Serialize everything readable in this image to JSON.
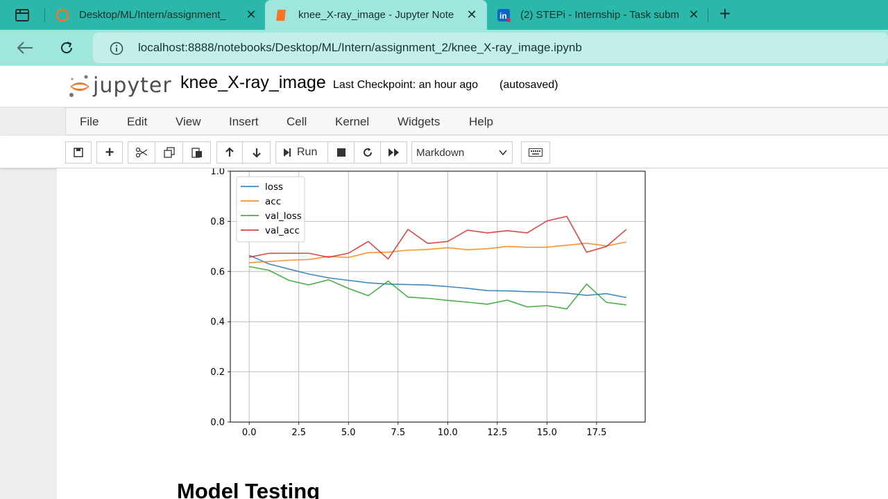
{
  "browser": {
    "tabs": [
      {
        "title": "Desktop/ML/Intern/assignment_",
        "icon": "jupyter-icon"
      },
      {
        "title": "knee_X-ray_image - Jupyter Note",
        "icon": "notebook-icon"
      },
      {
        "title": "(2) STEPi - Internship - Task subm",
        "icon": "linkedin-icon"
      }
    ],
    "url": "localhost:8888/notebooks/Desktop/ML/Intern/assignment_2/knee_X-ray_image.ipynb"
  },
  "jupyter": {
    "logo_text": "jupyter",
    "notebook_name": "knee_X-ray_image",
    "checkpoint": "Last Checkpoint: an hour ago",
    "autosave": "(autosaved)",
    "menu": [
      "File",
      "Edit",
      "View",
      "Insert",
      "Cell",
      "Kernel",
      "Widgets",
      "Help"
    ],
    "run_label": "Run",
    "cell_type": "Markdown"
  },
  "chart_data": {
    "type": "line",
    "x": [
      0,
      1,
      2,
      3,
      4,
      5,
      6,
      7,
      8,
      9,
      10,
      11,
      12,
      13,
      14,
      15,
      16,
      17,
      18,
      19
    ],
    "series": [
      {
        "name": "loss",
        "color": "#1f77b4",
        "values": [
          0.665,
          0.63,
          0.61,
          0.59,
          0.575,
          0.565,
          0.555,
          0.55,
          0.548,
          0.546,
          0.54,
          0.533,
          0.524,
          0.523,
          0.52,
          0.518,
          0.514,
          0.505,
          0.512,
          0.496
        ]
      },
      {
        "name": "acc",
        "color": "#ff7f0e",
        "values": [
          0.635,
          0.64,
          0.645,
          0.648,
          0.66,
          0.656,
          0.675,
          0.677,
          0.685,
          0.688,
          0.695,
          0.687,
          0.691,
          0.7,
          0.697,
          0.697,
          0.705,
          0.713,
          0.702,
          0.718
        ]
      },
      {
        "name": "val_loss",
        "color": "#2ca02c",
        "values": [
          0.62,
          0.605,
          0.565,
          0.547,
          0.567,
          0.533,
          0.504,
          0.562,
          0.498,
          0.493,
          0.485,
          0.478,
          0.47,
          0.486,
          0.459,
          0.464,
          0.451,
          0.55,
          0.477,
          0.467
        ]
      },
      {
        "name": "val_acc",
        "color": "#d62728",
        "values": [
          0.657,
          0.673,
          0.673,
          0.673,
          0.657,
          0.673,
          0.72,
          0.65,
          0.768,
          0.712,
          0.72,
          0.765,
          0.754,
          0.763,
          0.754,
          0.802,
          0.82,
          0.677,
          0.7,
          0.768
        ]
      }
    ],
    "xticks": [
      "0.0",
      "2.5",
      "5.0",
      "7.5",
      "10.0",
      "12.5",
      "15.0",
      "17.5"
    ],
    "xtick_values": [
      0,
      2.5,
      5,
      7.5,
      10,
      12.5,
      15,
      17.5
    ],
    "yticks": [
      "0.0",
      "0.2",
      "0.4",
      "0.6",
      "0.8",
      "1.0"
    ],
    "ytick_values": [
      0,
      0.2,
      0.4,
      0.6,
      0.8,
      1.0
    ],
    "xlim": [
      -0.95,
      19.95
    ],
    "ylim": [
      0,
      1.0
    ],
    "grid": true,
    "legend": "upper left",
    "title": "",
    "xlabel": "",
    "ylabel": ""
  },
  "notebook": {
    "heading": "Model Testing"
  }
}
